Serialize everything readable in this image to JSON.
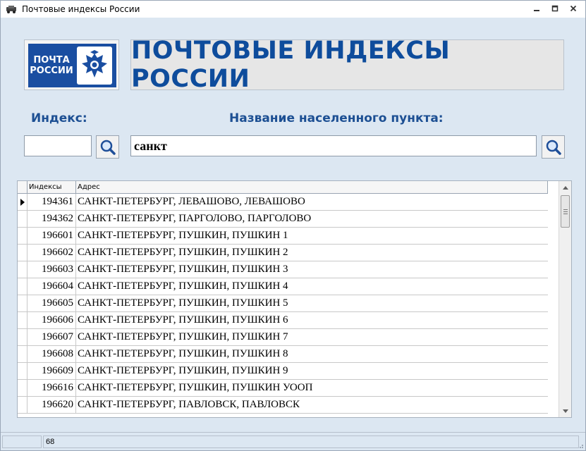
{
  "window": {
    "title": "Почтовые индексы России",
    "minimize_icon": "minimize-icon",
    "maximize_icon": "maximize-icon",
    "close_icon": "close-icon"
  },
  "banner": {
    "logo_line1": "ПОЧТА",
    "logo_line2": "РОССИИ",
    "title": "ПОЧТОВЫЕ ИНДЕКСЫ РОССИИ"
  },
  "search": {
    "index_label": "Индекс:",
    "index_value": "",
    "name_label": "Название населенного пункта:",
    "name_value": "санкт"
  },
  "grid": {
    "columns": [
      "Индексы",
      "Адрес"
    ],
    "selected_row": 0,
    "rows": [
      {
        "index": "194361",
        "address": "САНКТ-ПЕТЕРБУРГ, ЛЕВАШОВО, ЛЕВАШОВО"
      },
      {
        "index": "194362",
        "address": "САНКТ-ПЕТЕРБУРГ, ПАРГОЛОВО, ПАРГОЛОВО"
      },
      {
        "index": "196601",
        "address": "САНКТ-ПЕТЕРБУРГ, ПУШКИН, ПУШКИН 1"
      },
      {
        "index": "196602",
        "address": "САНКТ-ПЕТЕРБУРГ, ПУШКИН, ПУШКИН 2"
      },
      {
        "index": "196603",
        "address": "САНКТ-ПЕТЕРБУРГ, ПУШКИН, ПУШКИН 3"
      },
      {
        "index": "196604",
        "address": "САНКТ-ПЕТЕРБУРГ, ПУШКИН, ПУШКИН 4"
      },
      {
        "index": "196605",
        "address": "САНКТ-ПЕТЕРБУРГ, ПУШКИН, ПУШКИН 5"
      },
      {
        "index": "196606",
        "address": "САНКТ-ПЕТЕРБУРГ, ПУШКИН, ПУШКИН 6"
      },
      {
        "index": "196607",
        "address": "САНКТ-ПЕТЕРБУРГ, ПУШКИН, ПУШКИН 7"
      },
      {
        "index": "196608",
        "address": "САНКТ-ПЕТЕРБУРГ, ПУШКИН, ПУШКИН 8"
      },
      {
        "index": "196609",
        "address": "САНКТ-ПЕТЕРБУРГ, ПУШКИН, ПУШКИН 9"
      },
      {
        "index": "196616",
        "address": "САНКТ-ПЕТЕРБУРГ, ПУШКИН, ПУШКИН УООП"
      },
      {
        "index": "196620",
        "address": "САНКТ-ПЕТЕРБУРГ, ПАВЛОВСК, ПАВЛОВСК"
      }
    ]
  },
  "status": {
    "cell1": "",
    "cell2": "68"
  },
  "colors": {
    "accent": "#0e4c9c",
    "logo_bg": "#1a4ea1",
    "window_bg": "#dce7f2"
  }
}
